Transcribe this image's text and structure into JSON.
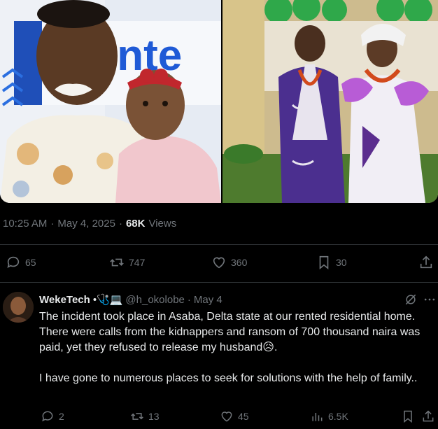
{
  "photos": {
    "left_sign_text": "inte",
    "right_alt": ""
  },
  "meta": {
    "time": "10:25 AM",
    "separator": "·",
    "date": "May 4, 2025",
    "views_count": "68K",
    "views_label": "Views"
  },
  "main_actions": {
    "replies": "65",
    "reposts": "747",
    "likes": "360",
    "bookmarks": "30"
  },
  "reply": {
    "name": "WekeTech",
    "name_emoji": "•🩺💻",
    "handle": "@h_okolobe",
    "dot": "·",
    "date": "May 4",
    "text": "The incident took place in Asaba, Delta state at our rented residential home. There were calls from the kidnappers and ransom of 700 thousand naira was paid, yet they refused to release my husband😥.\n\nI have gone to numerous places to seek for solutions with the help of family..",
    "actions": {
      "replies": "2",
      "reposts": "13",
      "likes": "45",
      "views": "6.5K"
    }
  },
  "colors": {
    "background": "#000000",
    "text": "#e7e9ea",
    "muted": "#71767b",
    "border": "#2f3336",
    "accent": "#1d9bf0"
  }
}
